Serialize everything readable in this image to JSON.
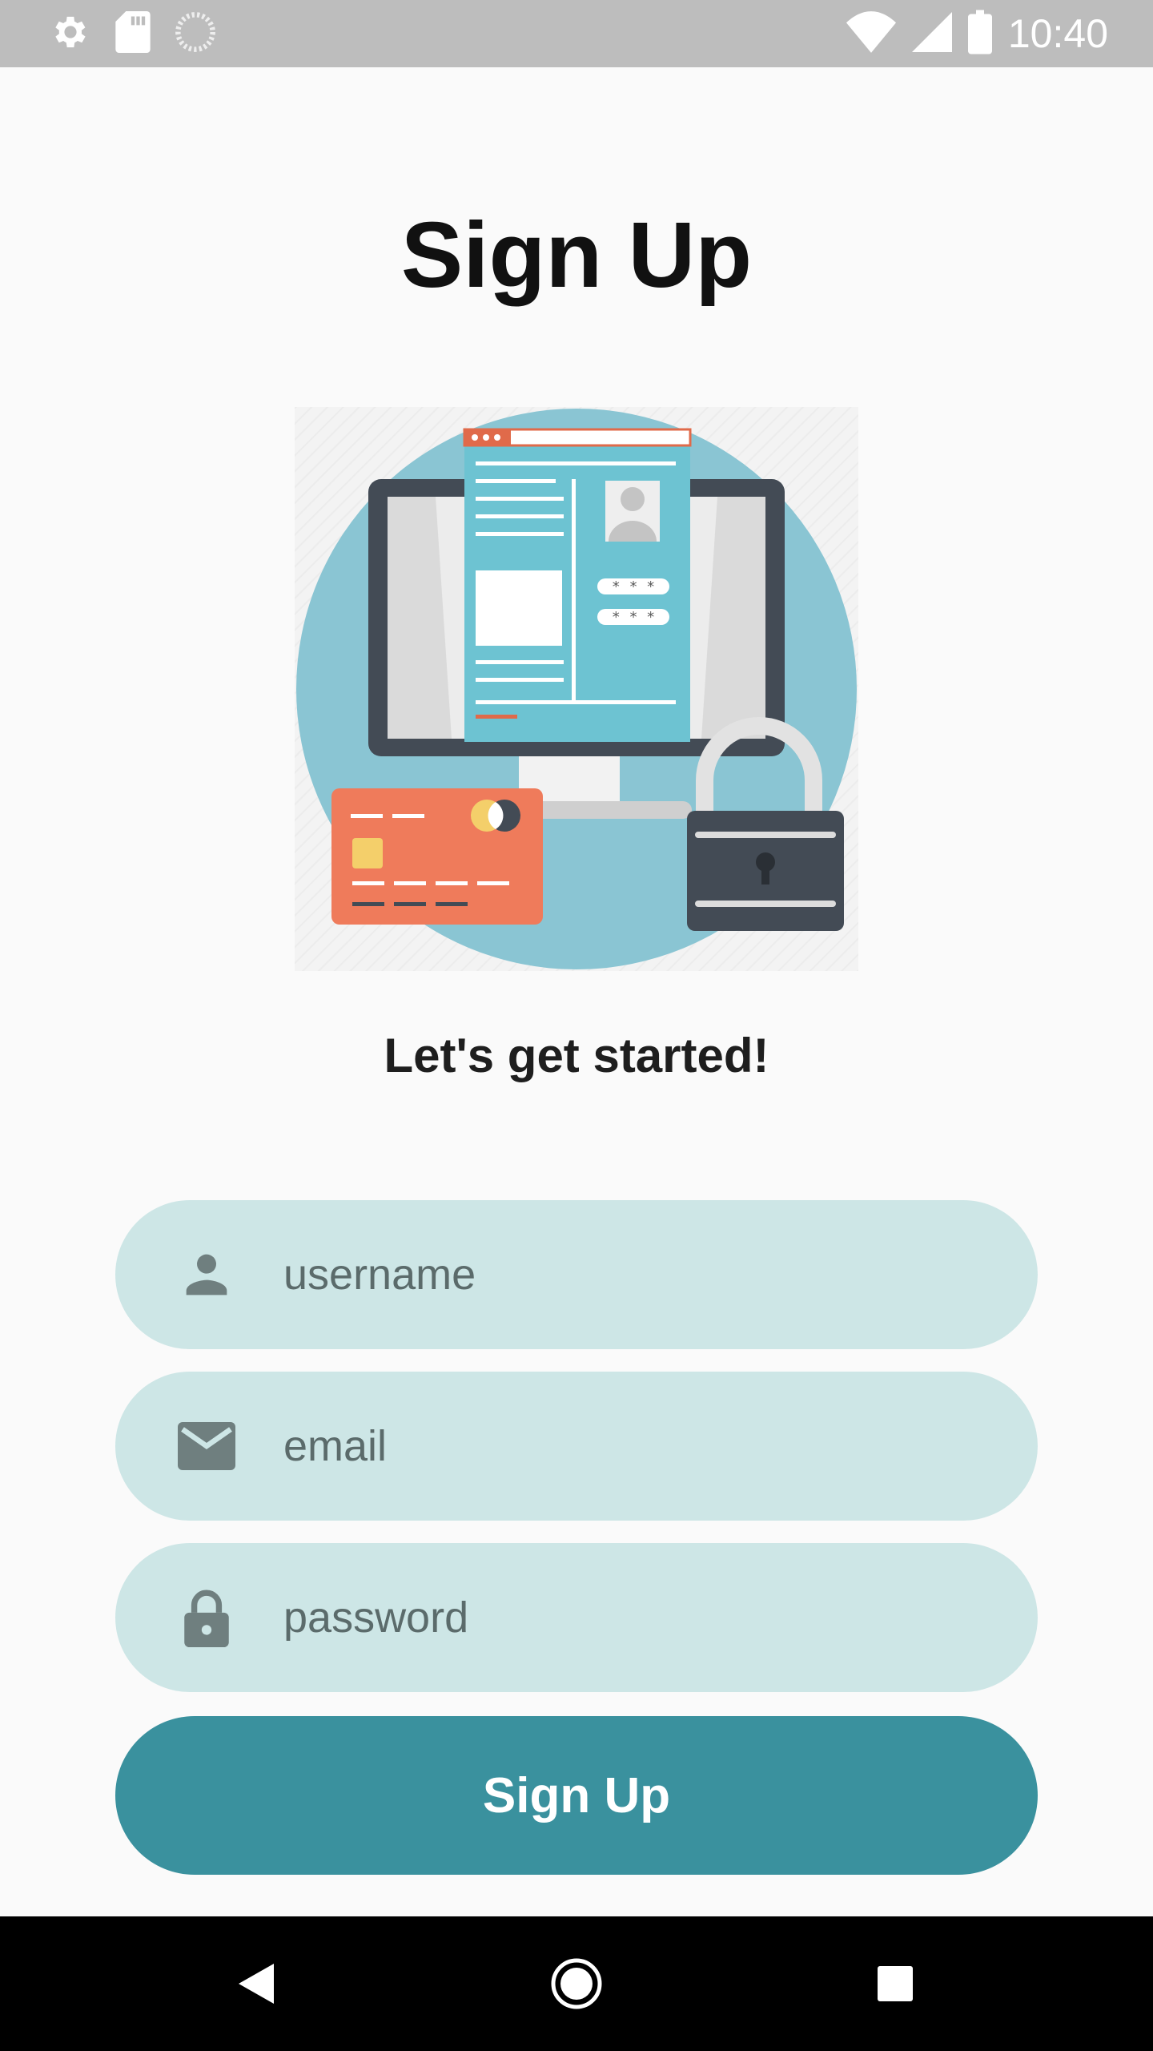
{
  "status_bar": {
    "time": "10:40",
    "left_icons": [
      "gear-icon",
      "sd-card-icon",
      "loading-icon"
    ],
    "right_icons": [
      "wifi-icon",
      "signal-icon",
      "battery-icon"
    ]
  },
  "page": {
    "title": "Sign Up",
    "subtitle": "Let's get started!"
  },
  "form": {
    "username": {
      "placeholder": "username",
      "value": "",
      "icon": "person-icon"
    },
    "email": {
      "placeholder": "email",
      "value": "",
      "icon": "mail-icon"
    },
    "password": {
      "placeholder": "password",
      "value": "",
      "icon": "lock-icon"
    },
    "submit_label": "Sign Up"
  },
  "nav_bar": {
    "buttons": [
      "back-icon",
      "home-icon",
      "recents-icon"
    ]
  },
  "colors": {
    "status_bar": "#bdbdbd",
    "background": "#fafafa",
    "field_bg": "#cde6e6",
    "button_bg": "#3a919e",
    "illustration_circle": "#8ac5d3",
    "card": "#ef7b5b",
    "monitor": "#434b55"
  }
}
